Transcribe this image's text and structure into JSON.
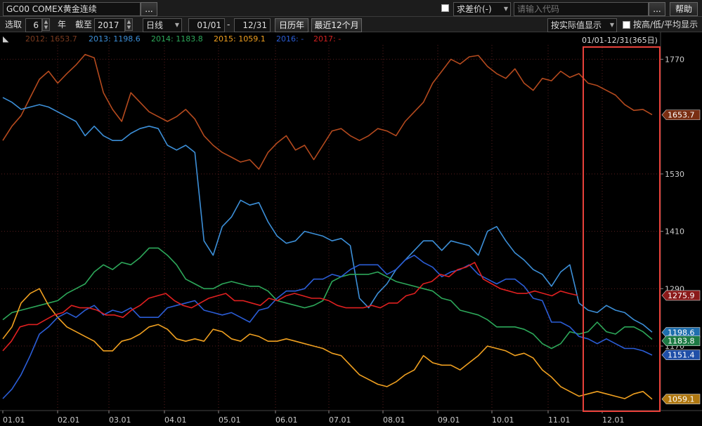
{
  "toolbar": {
    "symbol": "GC00  COMEX黄金连续",
    "more_btn": "...",
    "diff_price_label": "求差价(-)",
    "code_placeholder": "请输入代码",
    "help_btn": "帮助"
  },
  "controls": {
    "select_label": "选取",
    "years_count": "6",
    "year_unit": "年",
    "until_label": "截至",
    "until_year": "2017",
    "period": "日线",
    "date_from": "01/01",
    "date_sep": "-",
    "date_to": "12/31",
    "calendar_year_btn": "日历年",
    "recent_12m_btn": "最近12个月",
    "display_mode": "按实际值显示",
    "hl_avg_label": "按高/低/平均显示"
  },
  "range_label": "01/01-12/31(365日)",
  "chart_data": {
    "type": "line",
    "title": "",
    "xlabel": "",
    "ylabel": "",
    "x_ticks": [
      "01.01",
      "02.01",
      "03.01",
      "04.01",
      "05.01",
      "06.01",
      "07.01",
      "08.01",
      "09.01",
      "10.01",
      "11.01",
      "12.01"
    ],
    "y_ticks": [
      1170,
      1290,
      1410,
      1530,
      1770
    ],
    "ylim": [
      1035,
      1800
    ],
    "grid": true,
    "legend": "top-left",
    "highlight_box": "11.15-12.31",
    "series": [
      {
        "name": "2012",
        "legend_text": "2012: 1653.7",
        "color": "#b54a1e",
        "last": "1653.7",
        "values": [
          1600,
          1630,
          1652,
          1690,
          1728,
          1745,
          1720,
          1740,
          1758,
          1780,
          1773,
          1700,
          1665,
          1640,
          1700,
          1680,
          1660,
          1650,
          1640,
          1650,
          1665,
          1645,
          1610,
          1590,
          1575,
          1565,
          1555,
          1560,
          1540,
          1575,
          1595,
          1610,
          1580,
          1590,
          1560,
          1590,
          1620,
          1625,
          1610,
          1600,
          1610,
          1625,
          1620,
          1610,
          1640,
          1660,
          1680,
          1720,
          1745,
          1770,
          1760,
          1775,
          1778,
          1755,
          1740,
          1730,
          1750,
          1720,
          1705,
          1730,
          1725,
          1745,
          1732,
          1740,
          1720,
          1715,
          1705,
          1695,
          1675,
          1663,
          1665,
          1654
        ]
      },
      {
        "name": "2013",
        "legend_text": "2013: 1198.6",
        "color": "#3c8fd8",
        "last": "1198.6",
        "values": [
          1690,
          1680,
          1665,
          1670,
          1675,
          1670,
          1660,
          1650,
          1640,
          1610,
          1630,
          1610,
          1600,
          1600,
          1615,
          1625,
          1630,
          1625,
          1590,
          1580,
          1590,
          1575,
          1390,
          1360,
          1420,
          1440,
          1475,
          1465,
          1470,
          1430,
          1400,
          1385,
          1390,
          1410,
          1405,
          1400,
          1390,
          1395,
          1380,
          1270,
          1250,
          1280,
          1300,
          1330,
          1350,
          1370,
          1390,
          1390,
          1370,
          1390,
          1385,
          1380,
          1360,
          1410,
          1420,
          1390,
          1365,
          1350,
          1330,
          1320,
          1295,
          1325,
          1340,
          1260,
          1245,
          1240,
          1255,
          1245,
          1240,
          1225,
          1215,
          1199
        ]
      },
      {
        "name": "2014",
        "legend_text": "2014: 1183.8",
        "color": "#2da85a",
        "last": "1183.8",
        "values": [
          1225,
          1240,
          1245,
          1250,
          1255,
          1260,
          1265,
          1280,
          1290,
          1300,
          1325,
          1340,
          1330,
          1345,
          1340,
          1355,
          1375,
          1375,
          1360,
          1340,
          1310,
          1300,
          1290,
          1290,
          1300,
          1305,
          1300,
          1295,
          1295,
          1285,
          1265,
          1260,
          1255,
          1250,
          1255,
          1265,
          1305,
          1315,
          1320,
          1320,
          1320,
          1325,
          1315,
          1305,
          1300,
          1295,
          1290,
          1285,
          1270,
          1265,
          1245,
          1240,
          1235,
          1225,
          1210,
          1210,
          1210,
          1205,
          1195,
          1175,
          1165,
          1175,
          1200,
          1195,
          1200,
          1220,
          1200,
          1195,
          1210,
          1210,
          1200,
          1184
        ]
      },
      {
        "name": "2015",
        "legend_text": "2015: 1059.1",
        "color": "#f0a020",
        "last": "1059.1",
        "values": [
          1185,
          1210,
          1260,
          1280,
          1290,
          1255,
          1230,
          1210,
          1200,
          1190,
          1180,
          1160,
          1160,
          1180,
          1185,
          1195,
          1210,
          1215,
          1205,
          1185,
          1180,
          1185,
          1180,
          1205,
          1200,
          1185,
          1180,
          1195,
          1190,
          1180,
          1180,
          1185,
          1180,
          1175,
          1170,
          1165,
          1155,
          1150,
          1130,
          1110,
          1100,
          1090,
          1085,
          1095,
          1110,
          1120,
          1150,
          1135,
          1130,
          1130,
          1120,
          1135,
          1150,
          1170,
          1165,
          1160,
          1150,
          1155,
          1145,
          1120,
          1105,
          1085,
          1075,
          1065,
          1070,
          1075,
          1070,
          1065,
          1060,
          1070,
          1075,
          1059
        ]
      },
      {
        "name": "2016",
        "legend_text": "2016: -",
        "color": "#2b5dd6",
        "last": "1151.4",
        "values": [
          1060,
          1080,
          1110,
          1150,
          1195,
          1210,
          1230,
          1240,
          1230,
          1245,
          1255,
          1235,
          1245,
          1240,
          1250,
          1230,
          1230,
          1230,
          1250,
          1255,
          1260,
          1265,
          1245,
          1240,
          1235,
          1240,
          1230,
          1220,
          1245,
          1250,
          1270,
          1285,
          1285,
          1290,
          1310,
          1310,
          1320,
          1315,
          1330,
          1340,
          1340,
          1340,
          1320,
          1330,
          1350,
          1360,
          1345,
          1335,
          1315,
          1325,
          1330,
          1340,
          1320,
          1310,
          1300,
          1310,
          1310,
          1295,
          1270,
          1265,
          1220,
          1220,
          1210,
          1190,
          1185,
          1175,
          1185,
          1175,
          1165,
          1165,
          1160,
          1151
        ]
      },
      {
        "name": "2017",
        "legend_text": "2017: -",
        "color": "#e02020",
        "last": "1275.9",
        "values": [
          1160,
          1180,
          1210,
          1215,
          1215,
          1225,
          1235,
          1240,
          1255,
          1250,
          1250,
          1245,
          1235,
          1235,
          1230,
          1245,
          1255,
          1270,
          1275,
          1280,
          1265,
          1255,
          1250,
          1260,
          1270,
          1275,
          1280,
          1265,
          1265,
          1260,
          1255,
          1270,
          1265,
          1275,
          1280,
          1275,
          1270,
          1270,
          1265,
          1255,
          1250,
          1250,
          1250,
          1255,
          1250,
          1260,
          1260,
          1275,
          1280,
          1300,
          1305,
          1320,
          1315,
          1330,
          1335,
          1345,
          1310,
          1300,
          1290,
          1285,
          1280,
          1280,
          1285,
          1280,
          1275,
          1285,
          1280,
          1276
        ]
      }
    ]
  }
}
